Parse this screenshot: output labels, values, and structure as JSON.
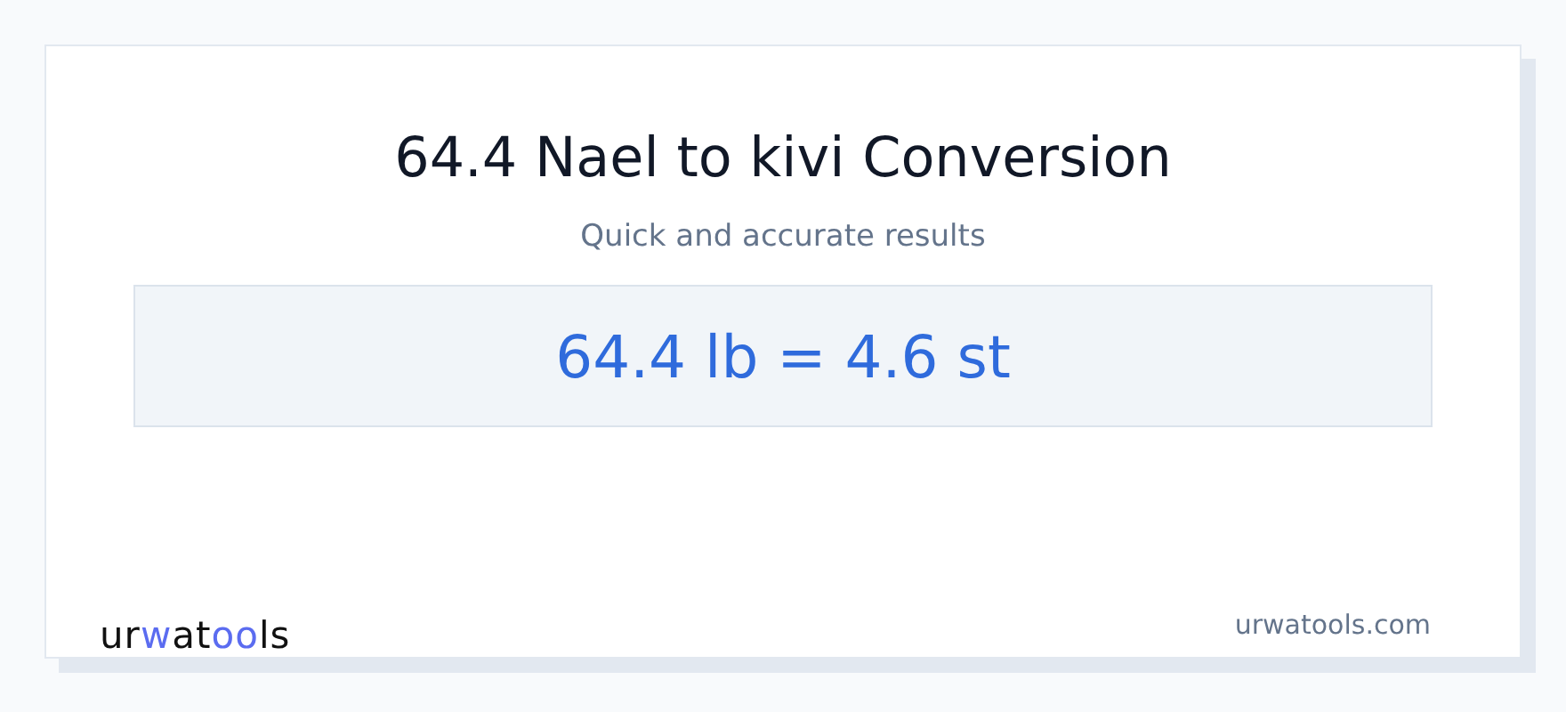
{
  "title": "64.4 Nael to kivi Conversion",
  "subtitle": "Quick and accurate results",
  "result": "64.4 lb = 4.6 st",
  "logo": {
    "parts": [
      {
        "text": "ur",
        "accent": false
      },
      {
        "text": "w",
        "accent": true
      },
      {
        "text": "at",
        "accent": false
      },
      {
        "text": "oo",
        "accent": true
      },
      {
        "text": "ls",
        "accent": false
      }
    ]
  },
  "site": "urwatools.com"
}
